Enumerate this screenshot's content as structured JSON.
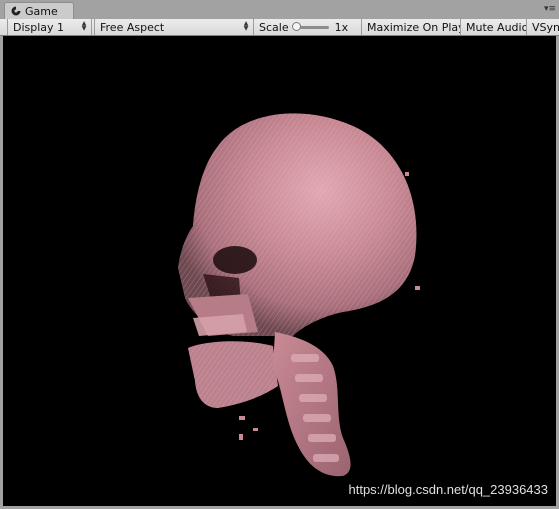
{
  "window": {
    "tab_title": "Game",
    "tab_icon": "game-controller-icon",
    "menu_icon": "context-menu-icon"
  },
  "toolbar": {
    "display_label": "Display 1",
    "aspect_label": "Free Aspect",
    "scale_label": "Scale",
    "scale_value": "1x",
    "scale_fraction": 0.0,
    "maximize_label": "Maximize On Play",
    "mute_label": "Mute Audio",
    "vsync_label": "VSync"
  },
  "viewport": {
    "background": "#000000",
    "render_color": "#c98a95",
    "watermark": "https://blog.csdn.net/qq_23936433"
  }
}
